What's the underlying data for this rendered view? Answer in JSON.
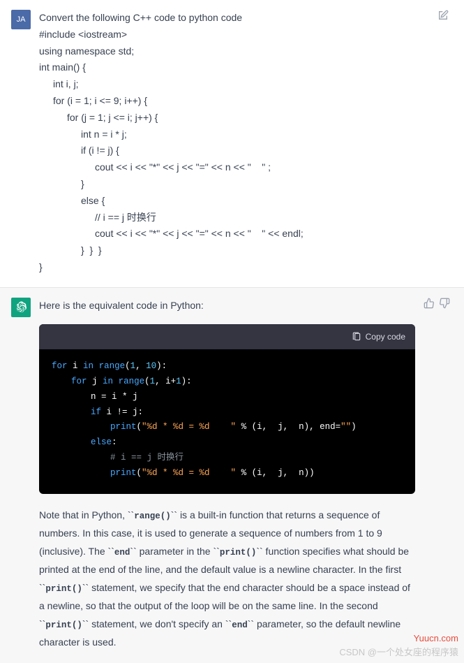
{
  "user": {
    "avatar": "JA",
    "lines": [
      {
        "t": "Convert the following C++ code to python code",
        "i": 0
      },
      {
        "t": "#include <iostream>",
        "i": 0
      },
      {
        "t": "using namespace std;",
        "i": 0
      },
      {
        "t": "int main() {",
        "i": 0
      },
      {
        "t": "int i, j;",
        "i": 1
      },
      {
        "t": "for (i = 1; i <= 9; i++) {",
        "i": 1
      },
      {
        "t": "for (j = 1; j <= i; j++) {",
        "i": 2
      },
      {
        "t": "int n = i * j;",
        "i": 3
      },
      {
        "t": "if (i != j) {",
        "i": 3
      },
      {
        "t": "cout << i << \"*\" << j << \"=\" << n << \"    \" ;",
        "i": 4
      },
      {
        "t": "}",
        "i": 3
      },
      {
        "t": "else {",
        "i": 3
      },
      {
        "t": "// i == j 时换行",
        "i": 4
      },
      {
        "t": "cout << i << \"*\" << j << \"=\" << n << \"    \" << endl;",
        "i": 4
      },
      {
        "t": "}  }  }",
        "i": 3
      },
      {
        "t": "}",
        "i": 0
      }
    ]
  },
  "assistant": {
    "intro": "Here is the equivalent code in Python:",
    "copy_label": "Copy code",
    "code": [
      {
        "i": 0,
        "seg": [
          [
            "kw",
            "for"
          ],
          [
            "id",
            " i "
          ],
          [
            "kw",
            "in"
          ],
          [
            "id",
            " "
          ],
          [
            "fn",
            "range"
          ],
          [
            "pn",
            "("
          ],
          [
            "num",
            "1"
          ],
          [
            "pn",
            ", "
          ],
          [
            "num",
            "10"
          ],
          [
            "pn",
            "):"
          ]
        ]
      },
      {
        "i": 1,
        "seg": [
          [
            "kw",
            "for"
          ],
          [
            "id",
            " j "
          ],
          [
            "kw",
            "in"
          ],
          [
            "id",
            " "
          ],
          [
            "fn",
            "range"
          ],
          [
            "pn",
            "("
          ],
          [
            "num",
            "1"
          ],
          [
            "pn",
            ", i+"
          ],
          [
            "num",
            "1"
          ],
          [
            "pn",
            "):"
          ]
        ]
      },
      {
        "i": 2,
        "seg": [
          [
            "id",
            "n = i * j"
          ]
        ]
      },
      {
        "i": 2,
        "seg": [
          [
            "kw",
            "if"
          ],
          [
            "id",
            " i != j:"
          ]
        ]
      },
      {
        "i": 3,
        "seg": [
          [
            "fn",
            "print"
          ],
          [
            "pn",
            "("
          ],
          [
            "str",
            "\"%d * %d = %d    \""
          ],
          [
            "id",
            " % (i,  j,  n), end="
          ],
          [
            "str",
            "\"\""
          ],
          [
            "pn",
            ")"
          ]
        ]
      },
      {
        "i": 2,
        "seg": [
          [
            "kw",
            "else"
          ],
          [
            "pn",
            ":"
          ]
        ]
      },
      {
        "i": 3,
        "seg": [
          [
            "cm",
            "# i == j 时换行"
          ]
        ]
      },
      {
        "i": 3,
        "seg": [
          [
            "fn",
            "print"
          ],
          [
            "pn",
            "("
          ],
          [
            "str",
            "\"%d * %d = %d    \""
          ],
          [
            "id",
            " % (i,  j,  n))"
          ]
        ]
      }
    ],
    "note_parts": [
      "Note that in Python, `",
      "range()",
      "` is a built-in function that returns a sequence of numbers. In this case, it is used to generate a sequence of numbers from 1 to 9 (inclusive). The `",
      "end",
      "` parameter in the `",
      "print()",
      "` function specifies what should be printed at the end of the line, and the default value is a newline character. In the first `",
      "print()",
      "` statement, we specify that the end character should be a space instead of a newline, so that the output of the loop will be on the same line. In the second `",
      "print()",
      "` statement, we don't specify an `",
      "end",
      "` parameter, so the default newline character is used."
    ]
  },
  "watermark": {
    "site": "Yuucn.com",
    "csdn": "CSDN @一个处女座的程序猿"
  }
}
